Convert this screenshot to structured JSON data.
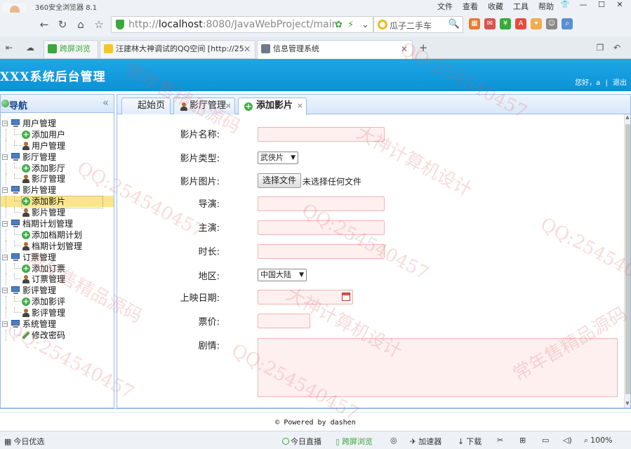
{
  "browser": {
    "name": "360安全浏览器 8.1",
    "menu": [
      "文件",
      "查看",
      "收藏",
      "工具",
      "帮助"
    ],
    "url_prefix": "http://",
    "url_host": "localhost",
    "url_rest": ":8080/JavaWebProject/main.j",
    "search_text": "瓜子二手车",
    "tabs": [
      {
        "label": "跨屏浏览",
        "active": false
      },
      {
        "label": "汪建林大神调试的QQ空间 [http://25",
        "active": false
      },
      {
        "label": "信息管理系统",
        "active": true
      }
    ],
    "new_tab": "+"
  },
  "app": {
    "title": "XXX系统后台管理",
    "greeting": "您好，a",
    "separator": "|",
    "logout": "退出"
  },
  "sidebar": {
    "title": "导航",
    "collapse": "«",
    "groups": [
      {
        "label": "用户管理",
        "children": [
          {
            "label": "添加用户",
            "icon": "add-icon"
          },
          {
            "label": "用户管理",
            "icon": "user-icon"
          }
        ]
      },
      {
        "label": "影厅管理",
        "children": [
          {
            "label": "添加影厅",
            "icon": "add-icon"
          },
          {
            "label": "影厅管理",
            "icon": "user-icon"
          }
        ]
      },
      {
        "label": "影片管理",
        "children": [
          {
            "label": "添加影片",
            "icon": "add-icon"
          },
          {
            "label": "影片管理",
            "icon": "user-icon"
          }
        ]
      },
      {
        "label": "档期计划管理",
        "children": [
          {
            "label": "添加档期计划",
            "icon": "add-icon"
          },
          {
            "label": "档期计划管理",
            "icon": "user-icon"
          }
        ]
      },
      {
        "label": "订票管理",
        "children": [
          {
            "label": "添加订票",
            "icon": "add-icon"
          },
          {
            "label": "订票管理",
            "icon": "user-icon"
          }
        ]
      },
      {
        "label": "影评管理",
        "children": [
          {
            "label": "添加影评",
            "icon": "add-icon"
          },
          {
            "label": "影评管理",
            "icon": "user-icon"
          }
        ]
      },
      {
        "label": "系统管理",
        "children": [
          {
            "label": "修改密码",
            "icon": "pencil-icon"
          }
        ]
      }
    ],
    "selected": "添加影片"
  },
  "content_tabs": [
    {
      "label": "起始页",
      "closable": false
    },
    {
      "label": "影厅管理",
      "closable": true
    },
    {
      "label": "添加影片",
      "closable": true,
      "active": true
    }
  ],
  "form": {
    "name_label": "影片名称:",
    "type_label": "影片类型:",
    "type_value": "武侠片",
    "image_label": "影片图片:",
    "file_button": "选择文件",
    "file_status": "未选择任何文件",
    "director_label": "导演:",
    "actor_label": "主演:",
    "duration_label": "时长:",
    "region_label": "地区:",
    "region_value": "中国大陆",
    "date_label": "上映日期:",
    "price_label": "票价:",
    "plot_label": "剧情:"
  },
  "footer": {
    "text": "© Powered by dashen"
  },
  "statusbar": {
    "left": "今日优选",
    "live": "今日直播",
    "cross": "跨屏浏览",
    "accel": "加速器",
    "download": "下载",
    "zoom": "100%"
  },
  "watermarks": [
    "常年售精品源码",
    "QQ:254540457",
    "大神计算机设计"
  ]
}
